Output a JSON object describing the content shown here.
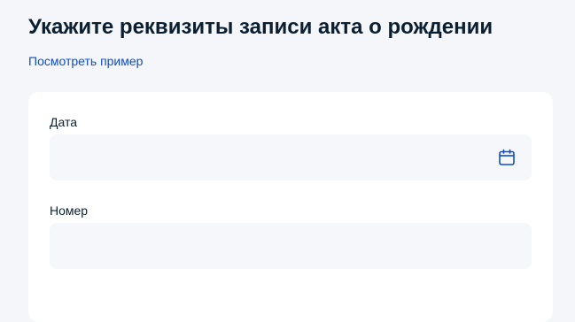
{
  "page": {
    "title": "Укажите реквизиты записи акта о рождении",
    "example_link": "Посмотреть пример"
  },
  "form": {
    "date": {
      "label": "Дата",
      "value": "",
      "icon": "calendar-icon"
    },
    "number": {
      "label": "Номер",
      "value": ""
    }
  },
  "colors": {
    "background": "#f4f6f9",
    "card": "#ffffff",
    "field": "#f5f7fa",
    "text": "#0b1f33",
    "link": "#0d4cd3"
  }
}
